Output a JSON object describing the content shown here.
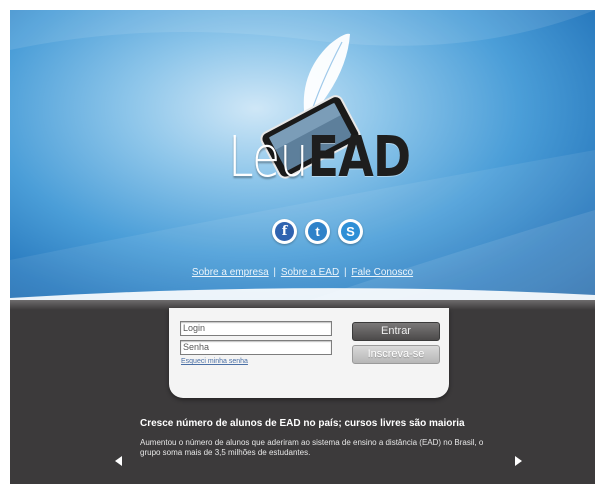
{
  "brand": {
    "name_part_a": "Leu",
    "name_part_b": "EAD",
    "logo_icon": "tablet-feather-icon"
  },
  "social": [
    {
      "icon": "facebook-icon",
      "glyph": "f"
    },
    {
      "icon": "twitter-icon",
      "glyph": "t"
    },
    {
      "icon": "skype-icon",
      "glyph": "S"
    }
  ],
  "nav_links": {
    "about_company": "Sobre a empresa",
    "about_ead": "Sobre a EAD",
    "contact": "Fale Conosco",
    "separator": "|"
  },
  "login": {
    "login_placeholder": "Login",
    "password_placeholder": "Senha",
    "forgot_password": "Esqueci minha senha",
    "enter_button": "Entrar",
    "signup_button": "Inscreva-se"
  },
  "news": {
    "headline": "Cresce número de alunos de EAD no país; cursos livres são maioria",
    "body": "Aumentou o número de alunos que aderiram ao sistema de ensino a distância (EAD) no Brasil, o grupo soma mais de 3,5 milhões de estudantes."
  },
  "colors": {
    "hero_blue": "#4b9ed8",
    "dark_band": "#3c3a3b",
    "enter_button": "#5c5a5a",
    "signup_button": "#c4c4c4"
  }
}
